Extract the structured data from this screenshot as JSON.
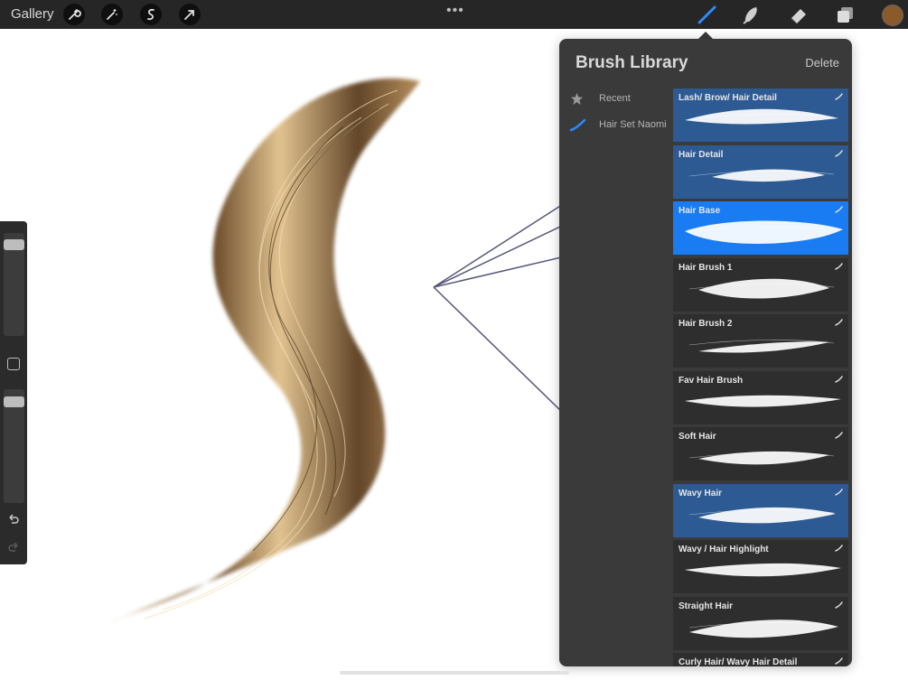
{
  "toolbar": {
    "gallery_label": "Gallery",
    "left_tools": [
      "wrench-icon",
      "magic-wand-icon",
      "selection-icon",
      "transform-arrow-icon"
    ],
    "more_icon": "ellipsis-icon",
    "right_tools": [
      "brush-icon",
      "smudge-icon",
      "eraser-icon",
      "layers-icon"
    ],
    "active_tool": "brush",
    "active_color": "#8a5a2a"
  },
  "sidebar": {
    "size_slider_level": 0.93,
    "opacity_slider_level": 0.93
  },
  "brush_library": {
    "title": "Brush Library",
    "delete_label": "Delete",
    "sets": [
      {
        "label": "Recent",
        "icon": "star-icon"
      },
      {
        "label": "Hair Set Naomi",
        "icon": "brush-stroke-icon"
      }
    ],
    "brushes": [
      {
        "name": "Lash/ Brow/ Hair Detail",
        "state": "selected"
      },
      {
        "name": "Hair Detail",
        "state": "selected"
      },
      {
        "name": "Hair Base",
        "state": "active"
      },
      {
        "name": "Hair Brush 1",
        "state": "normal"
      },
      {
        "name": "Hair Brush 2",
        "state": "normal"
      },
      {
        "name": "Fav Hair Brush",
        "state": "normal"
      },
      {
        "name": "Soft Hair",
        "state": "normal"
      },
      {
        "name": "Wavy Hair",
        "state": "selected"
      },
      {
        "name": "Wavy / Hair Highlight",
        "state": "normal"
      },
      {
        "name": "Straight Hair",
        "state": "normal"
      },
      {
        "name": "Curly Hair/ Wavy Hair Detail",
        "state": "normal"
      }
    ]
  },
  "colors": {
    "selected_card": "#2d5a93",
    "active_card": "#1a7cf2",
    "hair_mid": "#8a6a40"
  }
}
